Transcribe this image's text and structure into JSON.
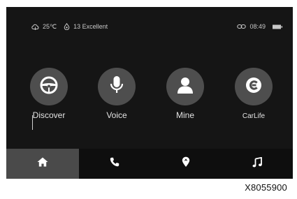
{
  "status_bar": {
    "temperature": "25℃",
    "air_quality": "13 Excellent",
    "time": "08:49"
  },
  "apps": [
    {
      "label": "Discover",
      "icon": "steering-wheel-icon"
    },
    {
      "label": "Voice",
      "icon": "microphone-icon"
    },
    {
      "label": "Mine",
      "icon": "person-icon"
    },
    {
      "label": "CarLife",
      "icon": "carlife-icon"
    }
  ],
  "dock": [
    {
      "icon": "home-icon",
      "active": true
    },
    {
      "icon": "phone-icon",
      "active": false
    },
    {
      "icon": "navigation-icon",
      "active": false
    },
    {
      "icon": "music-note-icon",
      "active": false
    }
  ],
  "image_code": "X8055900",
  "colors": {
    "screen_background": "#151515",
    "app_circle": "#4e4e4e",
    "dock_active": "#4a4a4a",
    "icon_white": "#ffffff"
  }
}
